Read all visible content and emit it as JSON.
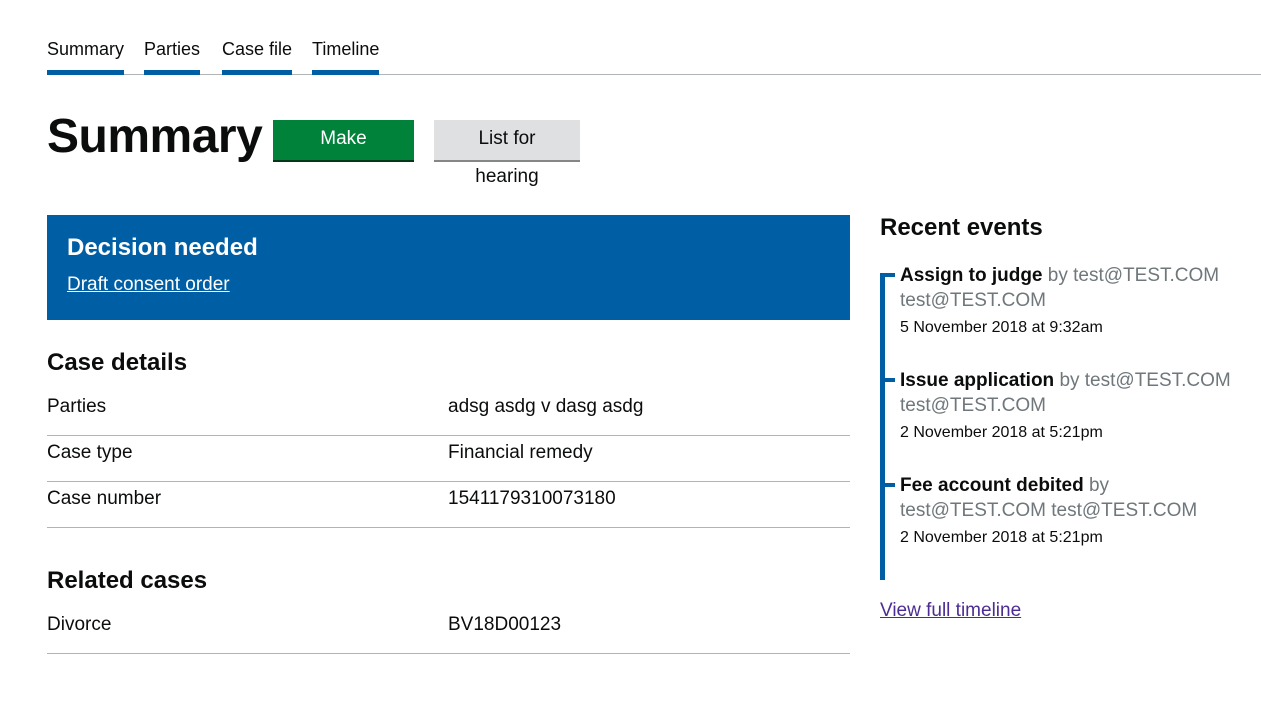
{
  "tabs": [
    {
      "label": "Summary"
    },
    {
      "label": "Parties"
    },
    {
      "label": "Case file"
    },
    {
      "label": "Timeline"
    }
  ],
  "header": {
    "title": "Summary",
    "make_decision_label": "Make decision",
    "list_for_hearing_label": "List for hearing"
  },
  "banner": {
    "title": "Decision needed",
    "link": "Draft consent order"
  },
  "case_details": {
    "title": "Case details",
    "rows": [
      {
        "key": "Parties",
        "value": "adsg asdg v dasg asdg"
      },
      {
        "key": "Case type",
        "value": "Financial remedy"
      },
      {
        "key": "Case number",
        "value": "1541179310073180"
      }
    ]
  },
  "related_cases": {
    "title": "Related cases",
    "rows": [
      {
        "key": "Divorce",
        "value": "BV18D00123"
      }
    ]
  },
  "recent_events": {
    "title": "Recent events",
    "events": [
      {
        "name": "Assign to judge",
        "by": "by test@TEST.COM test@TEST.COM",
        "date": "5 November 2018 at 9:32am"
      },
      {
        "name": "Issue application",
        "by": "by test@TEST.COM test@TEST.COM",
        "date": "2 November 2018 at 5:21pm"
      },
      {
        "name": "Fee account debited",
        "by": "by test@TEST.COM test@TEST.COM",
        "date": "2 November 2018 at 5:21pm"
      }
    ],
    "view_full_link": "View full timeline"
  },
  "colors": {
    "accent": "#005ea5",
    "primary_button": "#00823b",
    "secondary_button": "#dee0e2",
    "visited_link": "#4c2c92"
  }
}
